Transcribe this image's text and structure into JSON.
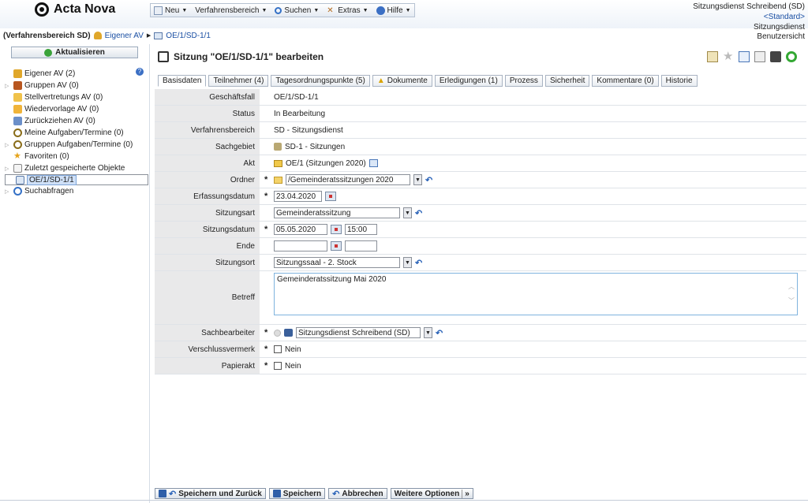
{
  "app": {
    "name": "Acta Nova"
  },
  "menu": [
    {
      "label": "Neu",
      "icon": "new-doc-icon"
    },
    {
      "label": "Verfahrensbereich",
      "icon": ""
    },
    {
      "label": "Suchen",
      "icon": "search-icon"
    },
    {
      "label": "Extras",
      "icon": "tools-icon"
    },
    {
      "label": "Hilfe",
      "icon": "help-icon"
    }
  ],
  "user": {
    "name": "Sitzungsdienst Schreibend (SD)",
    "profile": "<Standard>",
    "role": "Sitzungsdienst",
    "view": "Benutzersicht"
  },
  "breadcrumb": {
    "scope": "(Verfahrensbereich SD)",
    "items": [
      "Eigener AV",
      "OE/1/SD-1/1"
    ]
  },
  "sidebar": {
    "refresh_label": "Aktualisieren",
    "items": [
      {
        "label": "Eigener AV (2)",
        "expand": false
      },
      {
        "label": "Gruppen AV (0)",
        "expand": true
      },
      {
        "label": "Stellvertretungs AV (0)",
        "expand": false
      },
      {
        "label": "Wiedervorlage AV (0)",
        "expand": false
      },
      {
        "label": "Zurückziehen AV (0)",
        "expand": false
      },
      {
        "label": "Meine Aufgaben/Termine (0)",
        "expand": false
      },
      {
        "label": "Gruppen Aufgaben/Termine (0)",
        "expand": true
      },
      {
        "label": "Favoriten (0)",
        "expand": false
      },
      {
        "label": "Zuletzt gespeicherte Objekte",
        "expand": true
      },
      {
        "label": "OE/1/SD-1/1",
        "expand": false,
        "selected": true
      },
      {
        "label": "Suchabfragen",
        "expand": true
      }
    ]
  },
  "page": {
    "title": "Sitzung \"OE/1/SD-1/1\" bearbeiten"
  },
  "tabs": [
    {
      "label": "Basisdaten",
      "active": true
    },
    {
      "label": "Teilnehmer (4)"
    },
    {
      "label": "Tagesordnungspunkte (5)"
    },
    {
      "label": "Dokumente",
      "warn": true
    },
    {
      "label": "Erledigungen (1)"
    },
    {
      "label": "Prozess"
    },
    {
      "label": "Sicherheit"
    },
    {
      "label": "Kommentare (0)"
    },
    {
      "label": "Historie"
    }
  ],
  "form": {
    "geschaeftsfall": {
      "label": "Geschäftsfall",
      "value": "OE/1/SD-1/1"
    },
    "status": {
      "label": "Status",
      "value": "In Bearbeitung"
    },
    "verfahrensbereich": {
      "label": "Verfahrensbereich",
      "value": "SD - Sitzungsdienst"
    },
    "sachgebiet": {
      "label": "Sachgebiet",
      "value": "SD-1 - Sitzungen"
    },
    "akt": {
      "label": "Akt",
      "value": "OE/1 (Sitzungen 2020)"
    },
    "ordner": {
      "label": "Ordner",
      "value": "/Gemeinderatssitzungen 2020"
    },
    "erfassungsdatum": {
      "label": "Erfassungsdatum",
      "value": "23.04.2020"
    },
    "sitzungsart": {
      "label": "Sitzungsart",
      "value": "Gemeinderatssitzung"
    },
    "sitzungsdatum": {
      "label": "Sitzungsdatum",
      "date": "05.05.2020",
      "time": "15:00"
    },
    "ende": {
      "label": "Ende",
      "date": "",
      "time": ""
    },
    "sitzungsort": {
      "label": "Sitzungsort",
      "value": "Sitzungssaal - 2. Stock"
    },
    "betreff": {
      "label": "Betreff",
      "value": "Gemeinderatssitzung Mai 2020"
    },
    "sachbearbeiter": {
      "label": "Sachbearbeiter",
      "value": "Sitzungsdienst Schreibend  (SD)"
    },
    "verschlussvermerk": {
      "label": "Verschlussvermerk",
      "value": "Nein"
    },
    "papierakt": {
      "label": "Papierakt",
      "value": "Nein"
    }
  },
  "footer": {
    "save_back": "Speichern und Zurück",
    "save": "Speichern",
    "cancel": "Abbrechen",
    "more": "Weitere Optionen"
  }
}
